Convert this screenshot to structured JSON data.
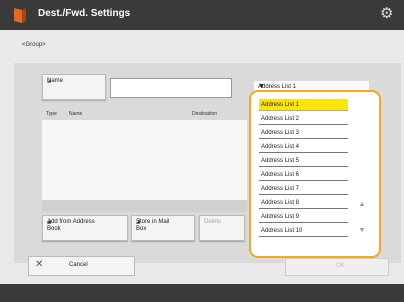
{
  "header": {
    "title": "Dest./Fwd. Settings",
    "icon": "book-icon",
    "settings_icon": "gear-icon"
  },
  "breadcrumb": "<Group>",
  "form": {
    "name_button": "Name",
    "name_value": "",
    "address_list_value": "Address List 1"
  },
  "list": {
    "columns": [
      "Type",
      "Name",
      "Destination"
    ]
  },
  "buttons": {
    "add_from_address_book": "Add from Address Book",
    "store_in_mail_box": "Store in Mail Box",
    "delete": "Delete",
    "cancel": "Cancel",
    "ok": "OK"
  },
  "dropdown": {
    "options": [
      "Address List 1",
      "Address List 2",
      "Address List 3",
      "Address List 4",
      "Address List 5",
      "Address List 6",
      "Address List 7",
      "Address List 8",
      "Address List 9",
      "Address List 10"
    ],
    "selected_index": 0,
    "accent_color": "#f5a623",
    "highlight_color": "#ffe600"
  }
}
